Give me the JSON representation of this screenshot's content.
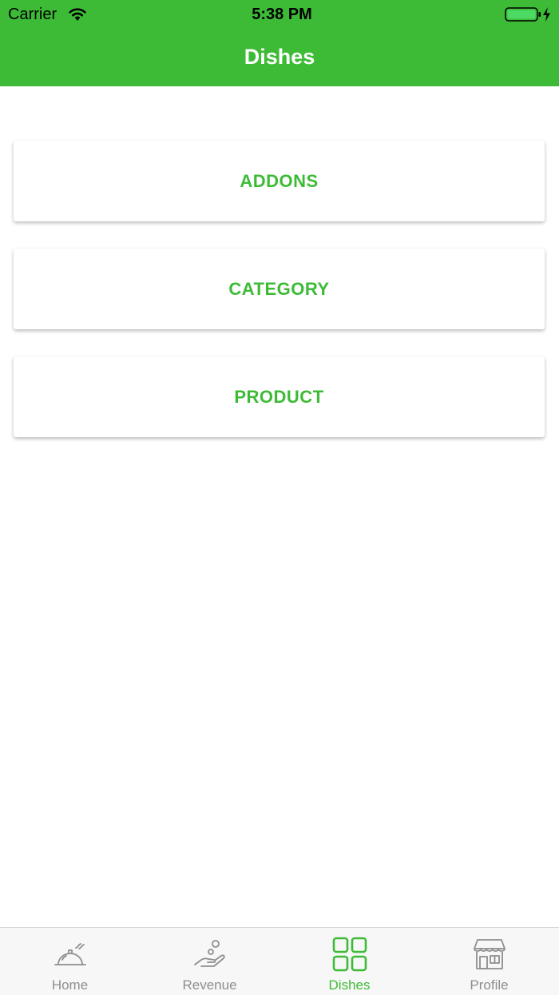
{
  "status_bar": {
    "carrier": "Carrier",
    "time": "5:38 PM",
    "wifi_icon": "wifi-icon",
    "battery_icon": "battery-charging-icon"
  },
  "header": {
    "title": "Dishes"
  },
  "menu": {
    "items": [
      {
        "label": "ADDONS"
      },
      {
        "label": "CATEGORY"
      },
      {
        "label": "PRODUCT"
      }
    ]
  },
  "tabbar": {
    "tabs": [
      {
        "label": "Home",
        "icon": "serving-cloche-icon",
        "active": false
      },
      {
        "label": "Revenue",
        "icon": "hand-coin-icon",
        "active": false
      },
      {
        "label": "Dishes",
        "icon": "grid-icon",
        "active": true
      },
      {
        "label": "Profile",
        "icon": "store-icon",
        "active": false
      }
    ]
  },
  "colors": {
    "accent": "#3dbb37",
    "inactive": "#8e8e8e",
    "tabbar_bg": "#f7f7f7"
  }
}
